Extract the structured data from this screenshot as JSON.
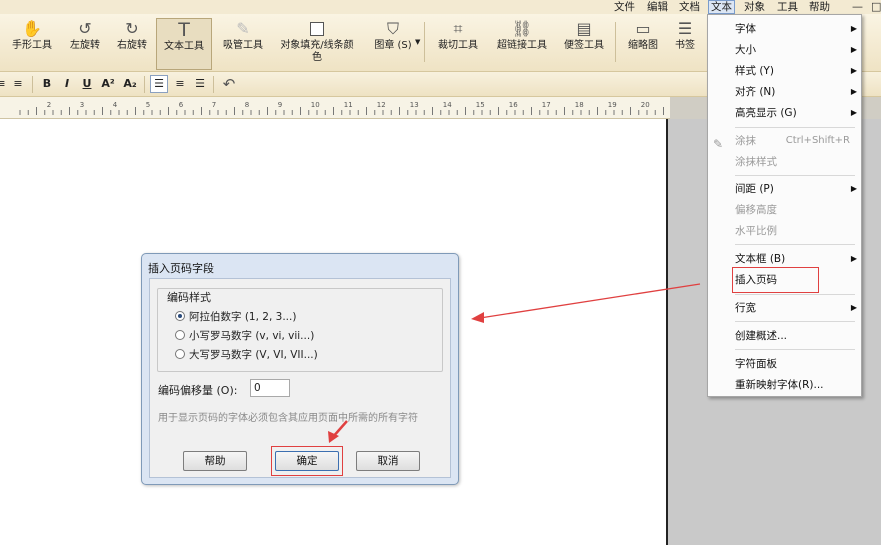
{
  "menubar": {
    "items": [
      "文件",
      "编辑",
      "文档",
      "文本",
      "对象",
      "工具",
      "帮助"
    ],
    "active": "文本",
    "window_buttons": [
      "—",
      "□"
    ]
  },
  "toolbar": {
    "tools": [
      {
        "label": "手形工具",
        "icon": "hand-icon"
      },
      {
        "label": "左旋转",
        "icon": "rotate-left-icon"
      },
      {
        "label": "右旋转",
        "icon": "rotate-right-icon"
      },
      {
        "label": "文本工具",
        "icon": "text-tool-icon"
      },
      {
        "label": "吸管工具",
        "icon": "eyedropper-icon"
      },
      {
        "label": "对象填充/线条颜色",
        "icon": "fill-color-icon"
      },
      {
        "label": "图章 (S)",
        "icon": "stamp-icon"
      },
      {
        "label": "裁切工具",
        "icon": "crop-icon"
      },
      {
        "label": "超链接工具",
        "icon": "link-icon"
      },
      {
        "label": "便签工具",
        "icon": "note-icon"
      },
      {
        "label": "缩略图",
        "icon": "thumbnail-icon"
      },
      {
        "label": "书签",
        "icon": "bookmark-icon"
      }
    ]
  },
  "formatbar": {
    "buttons": [
      "B",
      "I",
      "U",
      "A²",
      "A₂"
    ],
    "undo": "undo-icon"
  },
  "ruler": {
    "labels": [
      "2",
      "3",
      "4",
      "5",
      "6",
      "7",
      "8",
      "9",
      "10",
      "11",
      "12",
      "13",
      "14",
      "15",
      "16",
      "17",
      "18",
      "19",
      "20",
      "21"
    ]
  },
  "dialog": {
    "title": "插入页码字段",
    "group_label": "编码样式",
    "options": [
      "阿拉伯数字 (1, 2, 3...)",
      "小写罗马数字 (v, vi, vii...)",
      "大写罗马数字 (V, VI, VII...)"
    ],
    "selected_option": 0,
    "offset_label": "编码偏移量 (O):",
    "offset_value": "0",
    "hint": "用于显示页码的字体必须包含其应用页面中所需的所有字符",
    "buttons": {
      "help": "帮助",
      "ok": "确定",
      "cancel": "取消"
    }
  },
  "dropdown": {
    "items": [
      {
        "label": "字体",
        "submenu": true
      },
      {
        "label": "大小",
        "submenu": true
      },
      {
        "label": "样式 (Y)",
        "submenu": true
      },
      {
        "label": "对齐 (N)",
        "submenu": true
      },
      {
        "label": "高亮显示 (G)",
        "submenu": true
      },
      {
        "label": "涂抹",
        "shortcut": "Ctrl+Shift+R",
        "disabled": true
      },
      {
        "label": "涂抹样式",
        "disabled": true
      },
      {
        "label": "间距 (P)",
        "submenu": true
      },
      {
        "label": "偏移高度",
        "disabled": true
      },
      {
        "label": "水平比例",
        "disabled": true
      },
      {
        "label": "文本框 (B)",
        "submenu": true
      },
      {
        "label": "插入页码"
      },
      {
        "label": "行宽",
        "submenu": true
      },
      {
        "label": "创建概述..."
      },
      {
        "label": "字符面板"
      },
      {
        "label": "重新映射字体(R)..."
      }
    ]
  },
  "colors": {
    "toolbar_bg": "#f3ead2",
    "dialog_bg": "#dbe5f3",
    "annotation_red": "#e04040"
  }
}
